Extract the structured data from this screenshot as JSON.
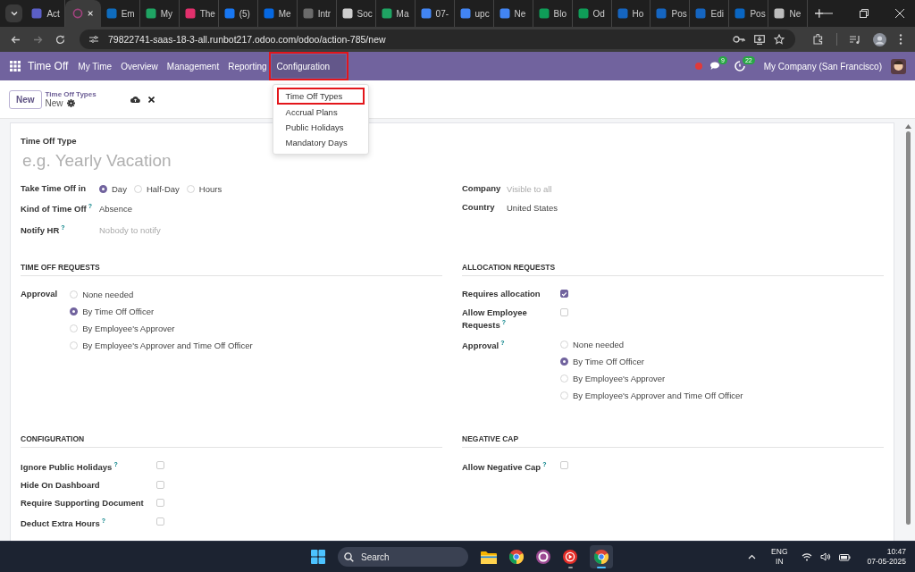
{
  "browser": {
    "tabs": [
      {
        "title": "Act",
        "color": "#5b5fc7",
        "selected": false
      },
      {
        "color": "#a3427f",
        "selected": true
      },
      {
        "title": "Em",
        "color": "#0f6cbd",
        "selected": false
      },
      {
        "title": "My",
        "color": "#1fa463",
        "selected": false
      },
      {
        "title": "The",
        "color": "#e1306c",
        "selected": false
      },
      {
        "title": "(5)",
        "color": "#1877f2",
        "selected": false
      },
      {
        "title": "Me",
        "color": "#0668e1",
        "selected": false
      },
      {
        "title": "Intr",
        "color": "#6b6b6b",
        "selected": false
      },
      {
        "title": "Soc",
        "color": "#cfcfcf",
        "selected": false
      },
      {
        "title": "Ma",
        "color": "#1fa463",
        "selected": false
      },
      {
        "title": "07-",
        "color": "#4285f4",
        "selected": false
      },
      {
        "title": "upc",
        "color": "#4285f4",
        "selected": false
      },
      {
        "title": "Ne",
        "color": "#4285f4",
        "selected": false
      },
      {
        "title": "Blo",
        "color": "#0f9d58",
        "selected": false
      },
      {
        "title": "Od",
        "color": "#0f9d58",
        "selected": false
      },
      {
        "title": "Ho",
        "color": "#1565c0",
        "selected": false
      },
      {
        "title": "Pos",
        "color": "#1565c0",
        "selected": false
      },
      {
        "title": "Edi",
        "color": "#1565c0",
        "selected": false
      },
      {
        "title": "Pos",
        "color": "#0a66c2",
        "selected": false
      },
      {
        "title": "Ne",
        "color": "#bdbdbd",
        "selected": false
      }
    ],
    "url": "79822741-saas-18-3-all.runbot217.odoo.com/odoo/action-785/new"
  },
  "navbar": {
    "app": "Time Off",
    "menu": [
      {
        "label": "My Time",
        "selected": false,
        "highlighted": false
      },
      {
        "label": "Overview",
        "selected": false,
        "highlighted": false
      },
      {
        "label": "Management",
        "selected": false,
        "highlighted": false
      },
      {
        "label": "Reporting",
        "selected": false,
        "highlighted": false
      },
      {
        "label": "Configuration",
        "selected": true,
        "highlighted": true
      }
    ],
    "dropdown": [
      {
        "label": "Time Off Types",
        "highlighted": true
      },
      {
        "label": "Accrual Plans",
        "highlighted": false
      },
      {
        "label": "Public Holidays",
        "highlighted": false
      },
      {
        "label": "Mandatory Days",
        "highlighted": false
      }
    ],
    "messages_count": "9",
    "activities_count": "22",
    "company": "My Company (San Francisco)"
  },
  "control_panel": {
    "new_button": "New",
    "breadcrumb": "Time Off Types",
    "record": "New"
  },
  "form": {
    "name_label": "Time Off Type",
    "name_placeholder": "e.g. Yearly Vacation",
    "groups": [
      {
        "fields": [
          {
            "kind": "radio",
            "label": "Take Time Off in",
            "options": [
              {
                "label": "Day",
                "selected": true
              },
              {
                "label": "Half-Day",
                "selected": false
              },
              {
                "label": "Hours",
                "selected": false
              }
            ]
          },
          {
            "kind": "text",
            "label": "Kind of Time Off",
            "help": "?",
            "value": "Absence"
          },
          {
            "kind": "placeholder",
            "label": "Notify HR",
            "help": "?",
            "placeholder": "Nobody to notify"
          }
        ]
      },
      {
        "fields": [
          {
            "kind": "placeholder",
            "label": "Company",
            "placeholder": "Visible to all"
          },
          {
            "kind": "text",
            "label": "Country",
            "value": "United States"
          }
        ]
      }
    ],
    "sections": [
      {
        "title": "TIME OFF REQUESTS",
        "fields": [
          {
            "kind": "radio",
            "label": "Approval",
            "options": [
              {
                "label": "None needed",
                "selected": false
              },
              {
                "label": "By Time Off Officer",
                "selected": true
              },
              {
                "label": "By Employee's Approver",
                "selected": false
              },
              {
                "label": "By Employee's Approver and Time Off Officer",
                "selected": false
              }
            ]
          }
        ]
      },
      {
        "title": "ALLOCATION REQUESTS",
        "fields": [
          {
            "kind": "checkbox",
            "label": "Requires allocation",
            "checked": true
          },
          {
            "kind": "checkbox",
            "label": "Allow Employee Requests",
            "help": "?",
            "checked": false
          },
          {
            "kind": "radio",
            "label": "Approval",
            "help": "?",
            "options": [
              {
                "label": "None needed",
                "selected": false
              },
              {
                "label": "By Time Off Officer",
                "selected": true
              },
              {
                "label": "By Employee's Approver",
                "selected": false
              },
              {
                "label": "By Employee's Approver and Time Off Officer",
                "selected": false
              }
            ]
          }
        ]
      },
      {
        "title": "CONFIGURATION",
        "fields": [
          {
            "kind": "checkbox",
            "label": "Ignore Public Holidays",
            "help": "?",
            "checked": false
          },
          {
            "kind": "checkbox",
            "label": "Hide On Dashboard",
            "checked": false
          },
          {
            "kind": "checkbox",
            "label": "Require Supporting Document",
            "checked": false
          },
          {
            "kind": "checkbox",
            "label": "Deduct Extra Hours",
            "help": "?",
            "checked": false
          }
        ]
      },
      {
        "title": "NEGATIVE CAP",
        "fields": [
          {
            "kind": "checkbox",
            "label": "Allow Negative Cap",
            "help": "?",
            "checked": false
          }
        ]
      }
    ]
  },
  "taskbar": {
    "search_placeholder": "Search",
    "language": "ENG",
    "region": "IN",
    "time": "10:47",
    "date": "07-05-2025"
  }
}
